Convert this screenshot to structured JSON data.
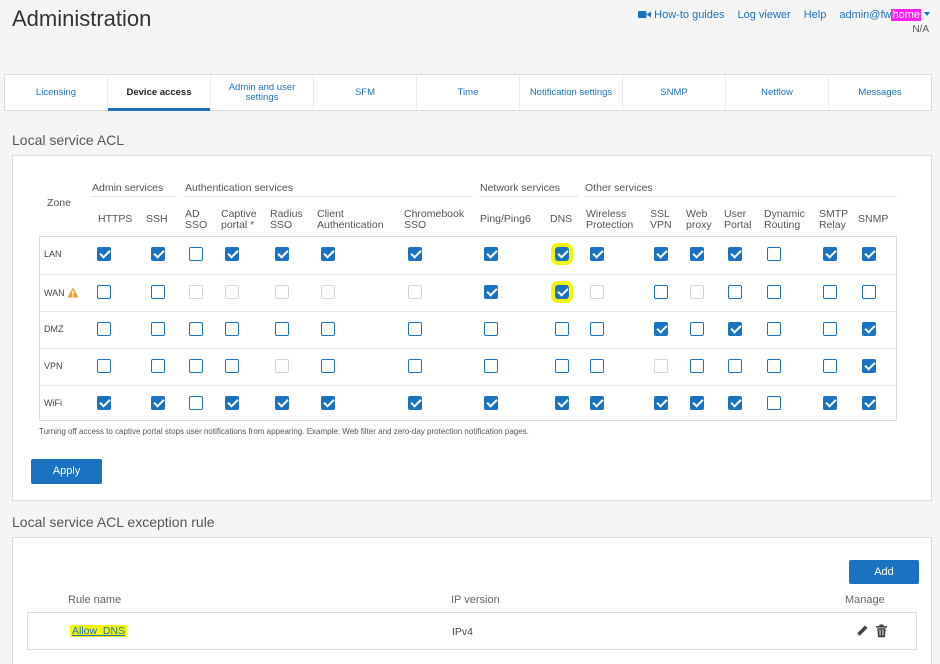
{
  "header": {
    "title": "Administration",
    "links": {
      "howto": "How-to guides",
      "logviewer": "Log viewer",
      "help": "Help"
    },
    "user": {
      "prefix": "admin@fw",
      "highlight": "home",
      "highlight_color": "#ff20ff"
    },
    "status": "N/A"
  },
  "tabs": [
    {
      "label": "Licensing",
      "active": false
    },
    {
      "label": "Device access",
      "active": true
    },
    {
      "label": "Admin and user settings",
      "active": false
    },
    {
      "label": "SFM",
      "active": false
    },
    {
      "label": "Time",
      "active": false
    },
    {
      "label": "Notification settings",
      "active": false
    },
    {
      "label": "SNMP",
      "active": false
    },
    {
      "label": "Netflow",
      "active": false
    },
    {
      "label": "Messages",
      "active": false
    }
  ],
  "acl": {
    "title": "Local service ACL",
    "zone_header": "Zone",
    "groups": [
      "Admin services",
      "Authentication services",
      "Network services",
      "Other services"
    ],
    "columns": [
      "HTTPS",
      "SSH",
      "AD SSO",
      "Captive portal *",
      "Radius SSO",
      "Client Authentication",
      "Chromebook SSO",
      "Ping/Ping6",
      "DNS",
      "Wireless Protection",
      "SSL VPN",
      "Web proxy",
      "User Portal",
      "Dynamic Routing",
      "SMTP Relay",
      "SNMP"
    ],
    "state_legend": {
      "1": "checked",
      "0": "unchecked",
      "2": "disabled"
    },
    "rows": [
      {
        "zone": "LAN",
        "warning": false,
        "states": [
          1,
          1,
          0,
          1,
          1,
          1,
          1,
          1,
          1,
          1,
          1,
          1,
          1,
          0,
          1,
          1
        ]
      },
      {
        "zone": "WAN",
        "warning": true,
        "states": [
          0,
          0,
          2,
          2,
          2,
          2,
          2,
          1,
          1,
          2,
          0,
          2,
          0,
          0,
          0,
          0
        ]
      },
      {
        "zone": "DMZ",
        "warning": false,
        "states": [
          0,
          0,
          0,
          0,
          0,
          0,
          0,
          0,
          0,
          0,
          1,
          0,
          1,
          0,
          0,
          1
        ]
      },
      {
        "zone": "VPN",
        "warning": false,
        "states": [
          0,
          0,
          0,
          0,
          2,
          0,
          0,
          0,
          0,
          0,
          2,
          0,
          0,
          0,
          0,
          1
        ]
      },
      {
        "zone": "WiFi",
        "warning": false,
        "states": [
          1,
          1,
          0,
          1,
          1,
          1,
          1,
          1,
          1,
          1,
          1,
          1,
          1,
          0,
          1,
          1
        ]
      }
    ],
    "highlighted_column": "DNS",
    "highlight_color": "#f5f50a",
    "note": "Turning off access to captive portal stops user notifications from appearing. Example: Web filter and zero-day protection notification pages.",
    "apply_label": "Apply"
  },
  "exceptions": {
    "title": "Local service ACL exception rule",
    "add_label": "Add",
    "headers": {
      "rule_name": "Rule name",
      "ip_version": "IP version",
      "manage": "Manage"
    },
    "rows": [
      {
        "rule_name": "Allow_DNS",
        "ip_version": "IPv4"
      }
    ]
  },
  "colors": {
    "accent": "#1a73c0",
    "highlight": "#f5f50a",
    "warning": "#f0a030"
  }
}
